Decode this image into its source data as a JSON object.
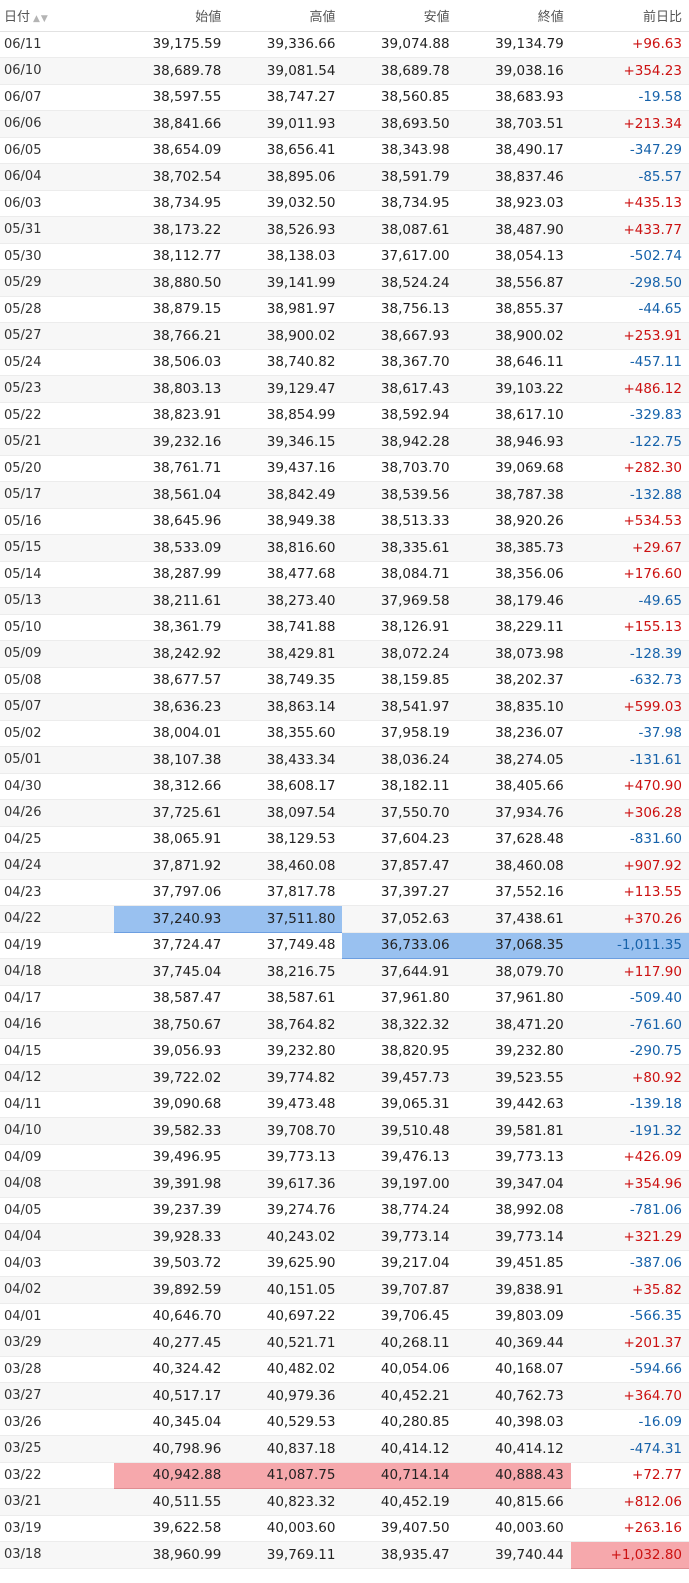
{
  "table": {
    "headers": {
      "date": "日付",
      "open": "始値",
      "high": "高値",
      "low": "安値",
      "close": "終値",
      "change": "前日比"
    },
    "sort_icon": "▲▼",
    "highlight_colors": {
      "high_blue": "#99c1f0",
      "low_red": "#f6a8ac"
    },
    "rows": [
      {
        "date": "06/11",
        "open": "39,175.59",
        "high": "39,336.66",
        "low": "39,074.88",
        "close": "39,134.79",
        "change": "+96.63",
        "dir": "up"
      },
      {
        "date": "06/10",
        "open": "38,689.78",
        "high": "39,081.54",
        "low": "38,689.78",
        "close": "39,038.16",
        "change": "+354.23",
        "dir": "up"
      },
      {
        "date": "06/07",
        "open": "38,597.55",
        "high": "38,747.27",
        "low": "38,560.85",
        "close": "38,683.93",
        "change": "-19.58",
        "dir": "down"
      },
      {
        "date": "06/06",
        "open": "38,841.66",
        "high": "39,011.93",
        "low": "38,693.50",
        "close": "38,703.51",
        "change": "+213.34",
        "dir": "up"
      },
      {
        "date": "06/05",
        "open": "38,654.09",
        "high": "38,656.41",
        "low": "38,343.98",
        "close": "38,490.17",
        "change": "-347.29",
        "dir": "down"
      },
      {
        "date": "06/04",
        "open": "38,702.54",
        "high": "38,895.06",
        "low": "38,591.79",
        "close": "38,837.46",
        "change": "-85.57",
        "dir": "down"
      },
      {
        "date": "06/03",
        "open": "38,734.95",
        "high": "39,032.50",
        "low": "38,734.95",
        "close": "38,923.03",
        "change": "+435.13",
        "dir": "up"
      },
      {
        "date": "05/31",
        "open": "38,173.22",
        "high": "38,526.93",
        "low": "38,087.61",
        "close": "38,487.90",
        "change": "+433.77",
        "dir": "up"
      },
      {
        "date": "05/30",
        "open": "38,112.77",
        "high": "38,138.03",
        "low": "37,617.00",
        "close": "38,054.13",
        "change": "-502.74",
        "dir": "down"
      },
      {
        "date": "05/29",
        "open": "38,880.50",
        "high": "39,141.99",
        "low": "38,524.24",
        "close": "38,556.87",
        "change": "-298.50",
        "dir": "down"
      },
      {
        "date": "05/28",
        "open": "38,879.15",
        "high": "38,981.97",
        "low": "38,756.13",
        "close": "38,855.37",
        "change": "-44.65",
        "dir": "down"
      },
      {
        "date": "05/27",
        "open": "38,766.21",
        "high": "38,900.02",
        "low": "38,667.93",
        "close": "38,900.02",
        "change": "+253.91",
        "dir": "up"
      },
      {
        "date": "05/24",
        "open": "38,506.03",
        "high": "38,740.82",
        "low": "38,367.70",
        "close": "38,646.11",
        "change": "-457.11",
        "dir": "down"
      },
      {
        "date": "05/23",
        "open": "38,803.13",
        "high": "39,129.47",
        "low": "38,617.43",
        "close": "39,103.22",
        "change": "+486.12",
        "dir": "up"
      },
      {
        "date": "05/22",
        "open": "38,823.91",
        "high": "38,854.99",
        "low": "38,592.94",
        "close": "38,617.10",
        "change": "-329.83",
        "dir": "down"
      },
      {
        "date": "05/21",
        "open": "39,232.16",
        "high": "39,346.15",
        "low": "38,942.28",
        "close": "38,946.93",
        "change": "-122.75",
        "dir": "down"
      },
      {
        "date": "05/20",
        "open": "38,761.71",
        "high": "39,437.16",
        "low": "38,703.70",
        "close": "39,069.68",
        "change": "+282.30",
        "dir": "up"
      },
      {
        "date": "05/17",
        "open": "38,561.04",
        "high": "38,842.49",
        "low": "38,539.56",
        "close": "38,787.38",
        "change": "-132.88",
        "dir": "down"
      },
      {
        "date": "05/16",
        "open": "38,645.96",
        "high": "38,949.38",
        "low": "38,513.33",
        "close": "38,920.26",
        "change": "+534.53",
        "dir": "up"
      },
      {
        "date": "05/15",
        "open": "38,533.09",
        "high": "38,816.60",
        "low": "38,335.61",
        "close": "38,385.73",
        "change": "+29.67",
        "dir": "up"
      },
      {
        "date": "05/14",
        "open": "38,287.99",
        "high": "38,477.68",
        "low": "38,084.71",
        "close": "38,356.06",
        "change": "+176.60",
        "dir": "up"
      },
      {
        "date": "05/13",
        "open": "38,211.61",
        "high": "38,273.40",
        "low": "37,969.58",
        "close": "38,179.46",
        "change": "-49.65",
        "dir": "down"
      },
      {
        "date": "05/10",
        "open": "38,361.79",
        "high": "38,741.88",
        "low": "38,126.91",
        "close": "38,229.11",
        "change": "+155.13",
        "dir": "up"
      },
      {
        "date": "05/09",
        "open": "38,242.92",
        "high": "38,429.81",
        "low": "38,072.24",
        "close": "38,073.98",
        "change": "-128.39",
        "dir": "down"
      },
      {
        "date": "05/08",
        "open": "38,677.57",
        "high": "38,749.35",
        "low": "38,159.85",
        "close": "38,202.37",
        "change": "-632.73",
        "dir": "down"
      },
      {
        "date": "05/07",
        "open": "38,636.23",
        "high": "38,863.14",
        "low": "38,541.97",
        "close": "38,835.10",
        "change": "+599.03",
        "dir": "up"
      },
      {
        "date": "05/02",
        "open": "38,004.01",
        "high": "38,355.60",
        "low": "37,958.19",
        "close": "38,236.07",
        "change": "-37.98",
        "dir": "down"
      },
      {
        "date": "05/01",
        "open": "38,107.38",
        "high": "38,433.34",
        "low": "38,036.24",
        "close": "38,274.05",
        "change": "-131.61",
        "dir": "down"
      },
      {
        "date": "04/30",
        "open": "38,312.66",
        "high": "38,608.17",
        "low": "38,182.11",
        "close": "38,405.66",
        "change": "+470.90",
        "dir": "up"
      },
      {
        "date": "04/26",
        "open": "37,725.61",
        "high": "38,097.54",
        "low": "37,550.70",
        "close": "37,934.76",
        "change": "+306.28",
        "dir": "up"
      },
      {
        "date": "04/25",
        "open": "38,065.91",
        "high": "38,129.53",
        "low": "37,604.23",
        "close": "37,628.48",
        "change": "-831.60",
        "dir": "down"
      },
      {
        "date": "04/24",
        "open": "37,871.92",
        "high": "38,460.08",
        "low": "37,857.47",
        "close": "38,460.08",
        "change": "+907.92",
        "dir": "up"
      },
      {
        "date": "04/23",
        "open": "37,797.06",
        "high": "37,817.78",
        "low": "37,397.27",
        "close": "37,552.16",
        "change": "+113.55",
        "dir": "up"
      },
      {
        "date": "04/22",
        "open": "37,240.93",
        "high": "37,511.80",
        "low": "37,052.63",
        "close": "37,438.61",
        "change": "+370.26",
        "dir": "up",
        "hl": {
          "open": "blue",
          "high": "blue"
        }
      },
      {
        "date": "04/19",
        "open": "37,724.47",
        "high": "37,749.48",
        "low": "36,733.06",
        "close": "37,068.35",
        "change": "-1,011.35",
        "dir": "down",
        "hl": {
          "low": "blue",
          "close": "blue",
          "change": "blue"
        }
      },
      {
        "date": "04/18",
        "open": "37,745.04",
        "high": "38,216.75",
        "low": "37,644.91",
        "close": "38,079.70",
        "change": "+117.90",
        "dir": "up"
      },
      {
        "date": "04/17",
        "open": "38,587.47",
        "high": "38,587.61",
        "low": "37,961.80",
        "close": "37,961.80",
        "change": "-509.40",
        "dir": "down"
      },
      {
        "date": "04/16",
        "open": "38,750.67",
        "high": "38,764.82",
        "low": "38,322.32",
        "close": "38,471.20",
        "change": "-761.60",
        "dir": "down"
      },
      {
        "date": "04/15",
        "open": "39,056.93",
        "high": "39,232.80",
        "low": "38,820.95",
        "close": "39,232.80",
        "change": "-290.75",
        "dir": "down"
      },
      {
        "date": "04/12",
        "open": "39,722.02",
        "high": "39,774.82",
        "low": "39,457.73",
        "close": "39,523.55",
        "change": "+80.92",
        "dir": "up"
      },
      {
        "date": "04/11",
        "open": "39,090.68",
        "high": "39,473.48",
        "low": "39,065.31",
        "close": "39,442.63",
        "change": "-139.18",
        "dir": "down"
      },
      {
        "date": "04/10",
        "open": "39,582.33",
        "high": "39,708.70",
        "low": "39,510.48",
        "close": "39,581.81",
        "change": "-191.32",
        "dir": "down"
      },
      {
        "date": "04/09",
        "open": "39,496.95",
        "high": "39,773.13",
        "low": "39,476.13",
        "close": "39,773.13",
        "change": "+426.09",
        "dir": "up"
      },
      {
        "date": "04/08",
        "open": "39,391.98",
        "high": "39,617.36",
        "low": "39,197.00",
        "close": "39,347.04",
        "change": "+354.96",
        "dir": "up"
      },
      {
        "date": "04/05",
        "open": "39,237.39",
        "high": "39,274.76",
        "low": "38,774.24",
        "close": "38,992.08",
        "change": "-781.06",
        "dir": "down"
      },
      {
        "date": "04/04",
        "open": "39,928.33",
        "high": "40,243.02",
        "low": "39,773.14",
        "close": "39,773.14",
        "change": "+321.29",
        "dir": "up"
      },
      {
        "date": "04/03",
        "open": "39,503.72",
        "high": "39,625.90",
        "low": "39,217.04",
        "close": "39,451.85",
        "change": "-387.06",
        "dir": "down"
      },
      {
        "date": "04/02",
        "open": "39,892.59",
        "high": "40,151.05",
        "low": "39,707.87",
        "close": "39,838.91",
        "change": "+35.82",
        "dir": "up"
      },
      {
        "date": "04/01",
        "open": "40,646.70",
        "high": "40,697.22",
        "low": "39,706.45",
        "close": "39,803.09",
        "change": "-566.35",
        "dir": "down"
      },
      {
        "date": "03/29",
        "open": "40,277.45",
        "high": "40,521.71",
        "low": "40,268.11",
        "close": "40,369.44",
        "change": "+201.37",
        "dir": "up"
      },
      {
        "date": "03/28",
        "open": "40,324.42",
        "high": "40,482.02",
        "low": "40,054.06",
        "close": "40,168.07",
        "change": "-594.66",
        "dir": "down"
      },
      {
        "date": "03/27",
        "open": "40,517.17",
        "high": "40,979.36",
        "low": "40,452.21",
        "close": "40,762.73",
        "change": "+364.70",
        "dir": "up"
      },
      {
        "date": "03/26",
        "open": "40,345.04",
        "high": "40,529.53",
        "low": "40,280.85",
        "close": "40,398.03",
        "change": "-16.09",
        "dir": "down"
      },
      {
        "date": "03/25",
        "open": "40,798.96",
        "high": "40,837.18",
        "low": "40,414.12",
        "close": "40,414.12",
        "change": "-474.31",
        "dir": "down"
      },
      {
        "date": "03/22",
        "open": "40,942.88",
        "high": "41,087.75",
        "low": "40,714.14",
        "close": "40,888.43",
        "change": "+72.77",
        "dir": "up",
        "hl": {
          "open": "red",
          "high": "red",
          "low": "red",
          "close": "red"
        }
      },
      {
        "date": "03/21",
        "open": "40,511.55",
        "high": "40,823.32",
        "low": "40,452.19",
        "close": "40,815.66",
        "change": "+812.06",
        "dir": "up"
      },
      {
        "date": "03/19",
        "open": "39,622.58",
        "high": "40,003.60",
        "low": "39,407.50",
        "close": "40,003.60",
        "change": "+263.16",
        "dir": "up"
      },
      {
        "date": "03/18",
        "open": "38,960.99",
        "high": "39,769.11",
        "low": "38,935.47",
        "close": "39,740.44",
        "change": "+1,032.80",
        "dir": "up",
        "hl": {
          "change": "red"
        }
      }
    ]
  }
}
